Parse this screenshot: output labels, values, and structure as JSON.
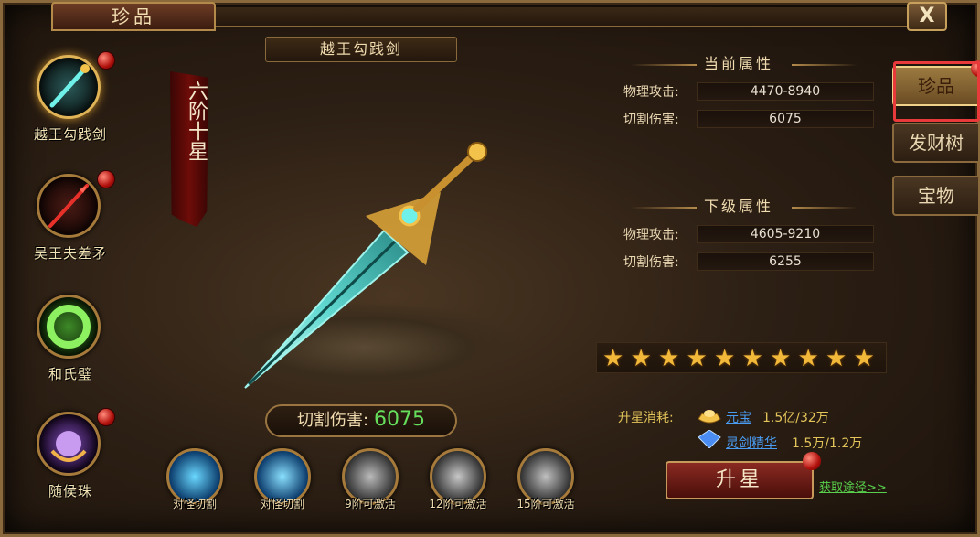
{
  "window": {
    "title": "珍品",
    "close_label": "X"
  },
  "treasures": [
    {
      "name": "越王勾践剑",
      "selected": true,
      "has_alert": true,
      "icon": "sword-icon"
    },
    {
      "name": "吴王夫差矛",
      "selected": false,
      "has_alert": true,
      "icon": "spear-icon"
    },
    {
      "name": "和氏璧",
      "selected": false,
      "has_alert": false,
      "icon": "jade-disc-icon"
    },
    {
      "name": "随侯珠",
      "selected": false,
      "has_alert": true,
      "icon": "pearl-icon"
    }
  ],
  "item": {
    "title": "越王勾践剑",
    "rank": "六阶十星",
    "damage_label": "切割伤害:",
    "damage_value": "6075"
  },
  "skills": [
    {
      "label": "对怪切割",
      "active": true
    },
    {
      "label": "对怪切割",
      "active": true
    },
    {
      "label": "9阶可激活",
      "active": false
    },
    {
      "label": "12阶可激活",
      "active": false
    },
    {
      "label": "15阶可激活",
      "active": false
    }
  ],
  "current_attrs": {
    "heading": "当前属性",
    "rows": [
      {
        "label": "物理攻击:",
        "value": "4470-8940"
      },
      {
        "label": "切割伤害:",
        "value": "6075"
      }
    ]
  },
  "next_attrs": {
    "heading": "下级属性",
    "rows": [
      {
        "label": "物理攻击:",
        "value": "4605-9210"
      },
      {
        "label": "切割伤害:",
        "value": "6255"
      }
    ]
  },
  "stars": {
    "filled": 10,
    "total": 10
  },
  "cost": {
    "label": "升星消耗:",
    "items": [
      {
        "name": "元宝",
        "value": "1.5亿/32万",
        "icon": "gold-ingot-icon"
      },
      {
        "name": "灵剑精华",
        "value": "1.5万/1.2万",
        "icon": "crystal-icon"
      }
    ]
  },
  "upgrade_button": "升星",
  "acquire_link": "获取途径>>",
  "right_tabs": [
    {
      "label": "珍品",
      "active": true
    },
    {
      "label": "发财树",
      "active": false
    },
    {
      "label": "宝物",
      "active": false
    }
  ],
  "colors": {
    "accent_gold": "#e3c45a",
    "link_blue": "#4a9cf2",
    "link_green": "#58d04c",
    "alert_red": "#b0100c"
  }
}
